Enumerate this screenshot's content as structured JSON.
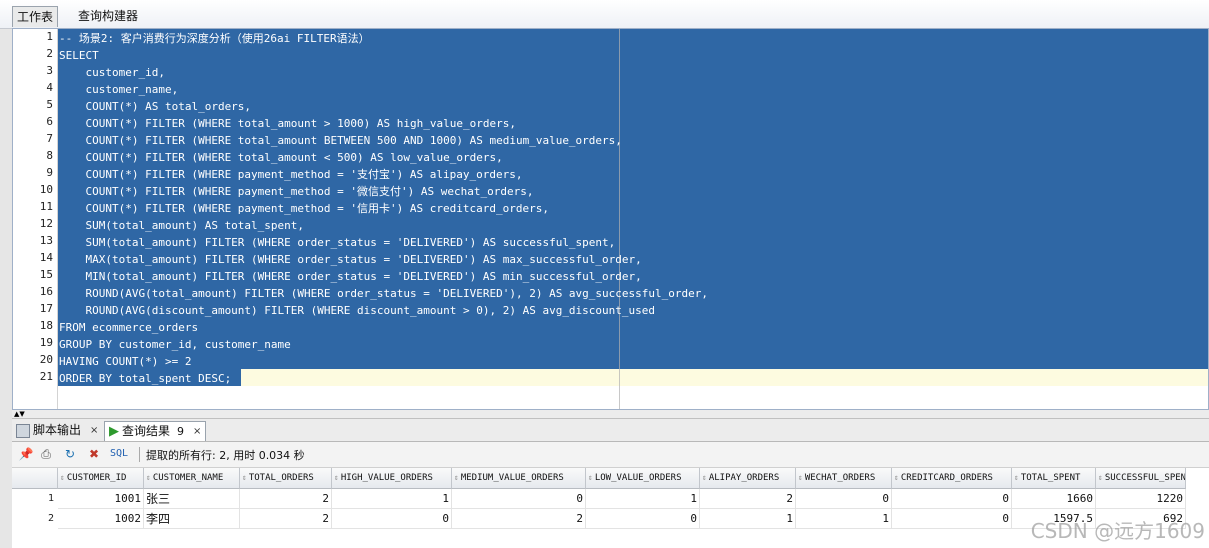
{
  "top_tabs": {
    "worksheet": "工作表",
    "query_builder": "查询构建器"
  },
  "editor": {
    "lines": [
      "-- 场景2: 客户消费行为深度分析（使用26ai FILTER语法）",
      "SELECT",
      "    customer_id,",
      "    customer_name,",
      "    COUNT(*) AS total_orders,",
      "    COUNT(*) FILTER (WHERE total_amount > 1000) AS high_value_orders,",
      "    COUNT(*) FILTER (WHERE total_amount BETWEEN 500 AND 1000) AS medium_value_orders,",
      "    COUNT(*) FILTER (WHERE total_amount < 500) AS low_value_orders,",
      "    COUNT(*) FILTER (WHERE payment_method = '支付宝') AS alipay_orders,",
      "    COUNT(*) FILTER (WHERE payment_method = '微信支付') AS wechat_orders,",
      "    COUNT(*) FILTER (WHERE payment_method = '信用卡') AS creditcard_orders,",
      "    SUM(total_amount) AS total_spent,",
      "    SUM(total_amount) FILTER (WHERE order_status = 'DELIVERED') AS successful_spent,",
      "    MAX(total_amount) FILTER (WHERE order_status = 'DELIVERED') AS max_successful_order,",
      "    MIN(total_amount) FILTER (WHERE order_status = 'DELIVERED') AS min_successful_order,",
      "    ROUND(AVG(total_amount) FILTER (WHERE order_status = 'DELIVERED'), 2) AS avg_successful_order,",
      "    ROUND(AVG(discount_amount) FILTER (WHERE discount_amount > 0), 2) AS avg_discount_used",
      "FROM ecommerce_orders",
      "GROUP BY customer_id, customer_name",
      "HAVING COUNT(*) >= 2",
      "ORDER BY total_spent DESC;"
    ],
    "line_numbers": [
      "1",
      "2",
      "3",
      "4",
      "5",
      "6",
      "7",
      "8",
      "9",
      "10",
      "11",
      "12",
      "13",
      "14",
      "15",
      "16",
      "17",
      "18",
      "19",
      "20",
      "21"
    ]
  },
  "result_tabs": {
    "script_output": "脚本输出",
    "query_result": "查询结果",
    "query_result_count": "9",
    "close": "×"
  },
  "result_toolbar": {
    "pin_icon": "pin-icon",
    "sql_label": "SQL",
    "status": "提取的所有行: 2, 用时 0.034 秒"
  },
  "grid": {
    "columns": [
      "CUSTOMER_ID",
      "CUSTOMER_NAME",
      "TOTAL_ORDERS",
      "HIGH_VALUE_ORDERS",
      "MEDIUM_VALUE_ORDERS",
      "LOW_VALUE_ORDERS",
      "ALIPAY_ORDERS",
      "WECHAT_ORDERS",
      "CREDITCARD_ORDERS",
      "TOTAL_SPENT",
      "SUCCESSFUL_SPENT"
    ],
    "rows": [
      {
        "num": "1",
        "cells": [
          "1001",
          "张三",
          "2",
          "1",
          "0",
          "1",
          "2",
          "0",
          "0",
          "1660",
          "1220"
        ]
      },
      {
        "num": "2",
        "cells": [
          "1002",
          "李四",
          "2",
          "0",
          "2",
          "0",
          "1",
          "1",
          "0",
          "1597.5",
          "692"
        ]
      }
    ]
  },
  "watermark": "CSDN @远方1609",
  "colors": {
    "selection": "#2f67a5",
    "current_line": "#fdfbe0",
    "sql_link": "#1f5fb0"
  }
}
